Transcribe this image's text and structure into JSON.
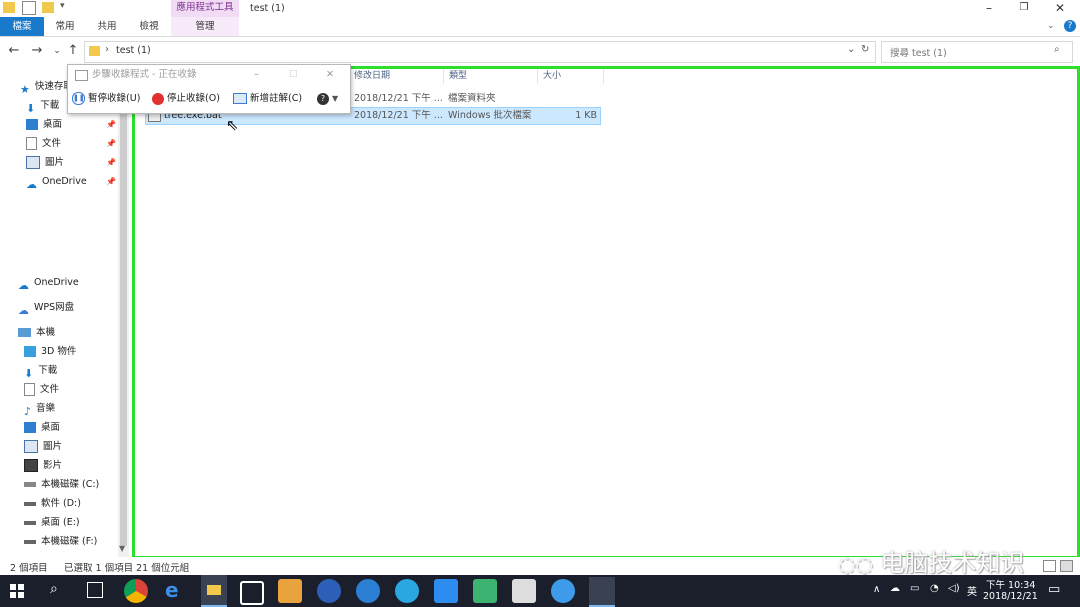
{
  "window": {
    "title": "test (1)",
    "context_header": "應用程式工具",
    "minimize_icon": "minimize-icon",
    "restore_icon": "restore-icon",
    "close_icon": "close-icon"
  },
  "ribbon": {
    "tabs": [
      "檔案",
      "常用",
      "共用",
      "檢視"
    ],
    "context_tab": "管理"
  },
  "address": {
    "path": "test (1)",
    "search_placeholder": "搜尋 test (1)"
  },
  "nav": {
    "items": [
      "快速存取",
      "下載",
      "桌面",
      "文件",
      "圖片",
      "OneDrive",
      "OneDrive",
      "WPS网盘",
      "本機",
      "3D 物件",
      "下載",
      "文件",
      "音樂",
      "桌面",
      "圖片",
      "影片",
      "本機磁碟 (C:)",
      "軟件 (D:)",
      "桌面 (E:)",
      "本機磁碟 (F:)"
    ]
  },
  "columns": [
    "修改日期",
    "類型",
    "大小"
  ],
  "files": [
    {
      "name": "",
      "date": "2018/12/21 下午 ...",
      "type": "檔案資料夾",
      "size": ""
    },
    {
      "name": "tree.exe.bat",
      "date": "2018/12/21 下午 ...",
      "type": "Windows 批次檔案",
      "size": "1 KB"
    }
  ],
  "steps_recorder": {
    "title": "步驟收錄程式 - 正在收錄",
    "pause": "暫停收錄(U)",
    "stop": "停止收錄(O)",
    "comment": "新增註解(C)"
  },
  "status": {
    "count": "2 個項目",
    "selected": "已選取 1 個項目 21 個位元組"
  },
  "taskbar": {
    "ime": "英",
    "time": "下午 10:34",
    "date": "2018/12/21"
  },
  "watermark": "电脑技术知识",
  "colors": {
    "accent": "#1979ca",
    "selection": "#cce8ff",
    "highlight_box": "#2bdf2b",
    "taskbar": "#1a1f2b"
  }
}
